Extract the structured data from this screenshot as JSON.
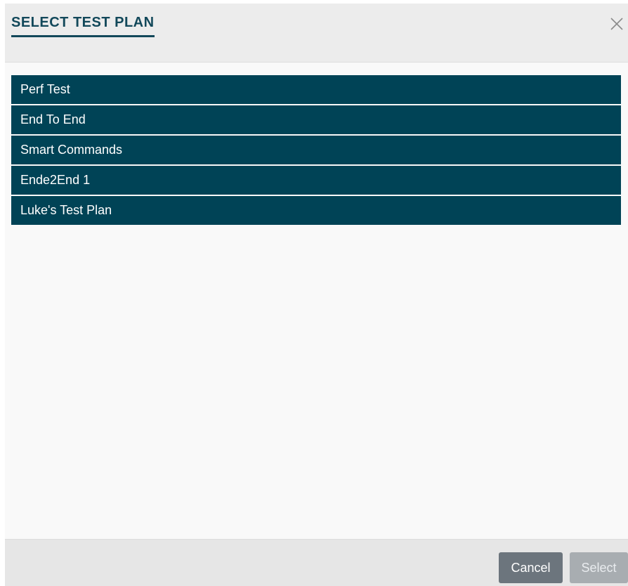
{
  "dialog": {
    "title": "SELECT TEST PLAN",
    "close_icon": "close-icon",
    "plans": [
      {
        "label": "Perf Test"
      },
      {
        "label": "End To End"
      },
      {
        "label": "Smart Commands"
      },
      {
        "label": "Ende2End 1"
      },
      {
        "label": "Luke's Test Plan"
      }
    ],
    "footer": {
      "cancel_label": "Cancel",
      "select_label": "Select",
      "select_disabled": true
    }
  },
  "colors": {
    "accent": "#12485a",
    "list_item_bg": "#004356",
    "list_item_text": "#ffffff",
    "header_bg": "#ececec",
    "footer_bg": "#e6e6e6",
    "cancel_bg": "#6c757d",
    "select_bg_disabled": "#a8adb1"
  }
}
